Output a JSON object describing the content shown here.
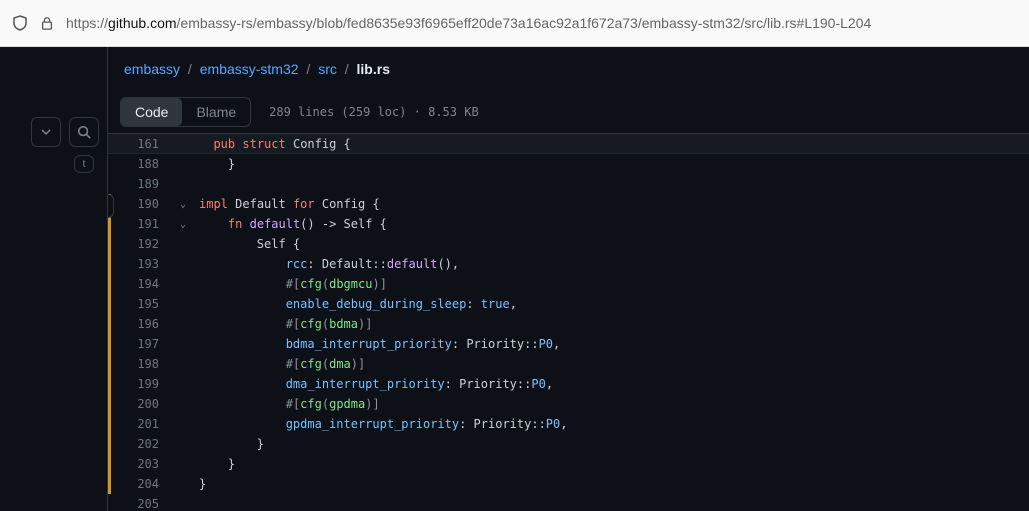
{
  "url": {
    "pre": "https://",
    "host": "github.com",
    "path": "/embassy-rs/embassy/blob/fed8635e93f6965eff20de73a16ac92a1f672a73/embassy-stm32/src/lib.rs#L190-L204"
  },
  "left": {
    "tkey": "t"
  },
  "crumbs": {
    "p0": "embassy",
    "p1": "embassy-stm32",
    "p2": "src",
    "cur": "lib.rs",
    "sep": "/"
  },
  "tabs": {
    "code": "Code",
    "blame": "Blame"
  },
  "stats": "289 lines (259 loc) · 8.53 KB",
  "lines": {
    "l161": "161",
    "l188": "188",
    "l189": "189",
    "l190": "190",
    "l191": "191",
    "l192": "192",
    "l193": "193",
    "l194": "194",
    "l195": "195",
    "l196": "196",
    "l197": "197",
    "l198": "198",
    "l199": "199",
    "l200": "200",
    "l201": "201",
    "l202": "202",
    "l203": "203",
    "l204": "204",
    "l205": "205"
  },
  "code": {
    "c161_kw1": "pub",
    "c161_sp1": " ",
    "c161_kw2": "struct",
    "c161_sp2": " ",
    "c161_id": "Config ",
    "c161_br": "{",
    "c188": "    }",
    "c189": "",
    "c190_kw1": "impl",
    "c190_sp1": " ",
    "c190_id1": "Default ",
    "c190_kw2": "for",
    "c190_sp2": " ",
    "c190_id2": "Config ",
    "c190_br": "{",
    "c191_ind": "    ",
    "c191_kw": "fn",
    "c191_sp": " ",
    "c191_fn": "default",
    "c191_rest": "() -> Self {",
    "c192": "        Self {",
    "c193_ind": "            ",
    "c193_f": "rcc",
    "c193_col": ": ",
    "c193_mid": "Default::",
    "c193_fn": "default",
    "c193_end": "(),",
    "c194_ind": "            ",
    "c194_a": "#",
    "c194_b": "[",
    "c194_c": "cfg",
    "c194_d": "(",
    "c194_e": "dbgmcu",
    "c194_f": ")",
    "c194_g": "]",
    "c195_ind": "            ",
    "c195_f": "enable_debug_during_sleep",
    "c195_col": ": ",
    "c195_v": "true",
    "c195_end": ",",
    "c196_ind": "            ",
    "c196_a": "#",
    "c196_b": "[",
    "c196_c": "cfg",
    "c196_d": "(",
    "c196_e": "bdma",
    "c196_f": ")",
    "c196_g": "]",
    "c197_ind": "            ",
    "c197_f": "bdma_interrupt_priority",
    "c197_col": ": ",
    "c197_mid": "Priority::",
    "c197_v": "P0",
    "c197_end": ",",
    "c198_ind": "            ",
    "c198_a": "#",
    "c198_b": "[",
    "c198_c": "cfg",
    "c198_d": "(",
    "c198_e": "dma",
    "c198_f": ")",
    "c198_g": "]",
    "c199_ind": "            ",
    "c199_f": "dma_interrupt_priority",
    "c199_col": ": ",
    "c199_mid": "Priority::",
    "c199_v": "P0",
    "c199_end": ",",
    "c200_ind": "            ",
    "c200_a": "#",
    "c200_b": "[",
    "c200_c": "cfg",
    "c200_d": "(",
    "c200_e": "gpdma",
    "c200_f": ")",
    "c200_g": "]",
    "c201_ind": "            ",
    "c201_f": "gpdma_interrupt_priority",
    "c201_col": ": ",
    "c201_mid": "Priority::",
    "c201_v": "P0",
    "c201_end": ",",
    "c202": "        }",
    "c203": "    }",
    "c204": "}",
    "c205": ""
  }
}
